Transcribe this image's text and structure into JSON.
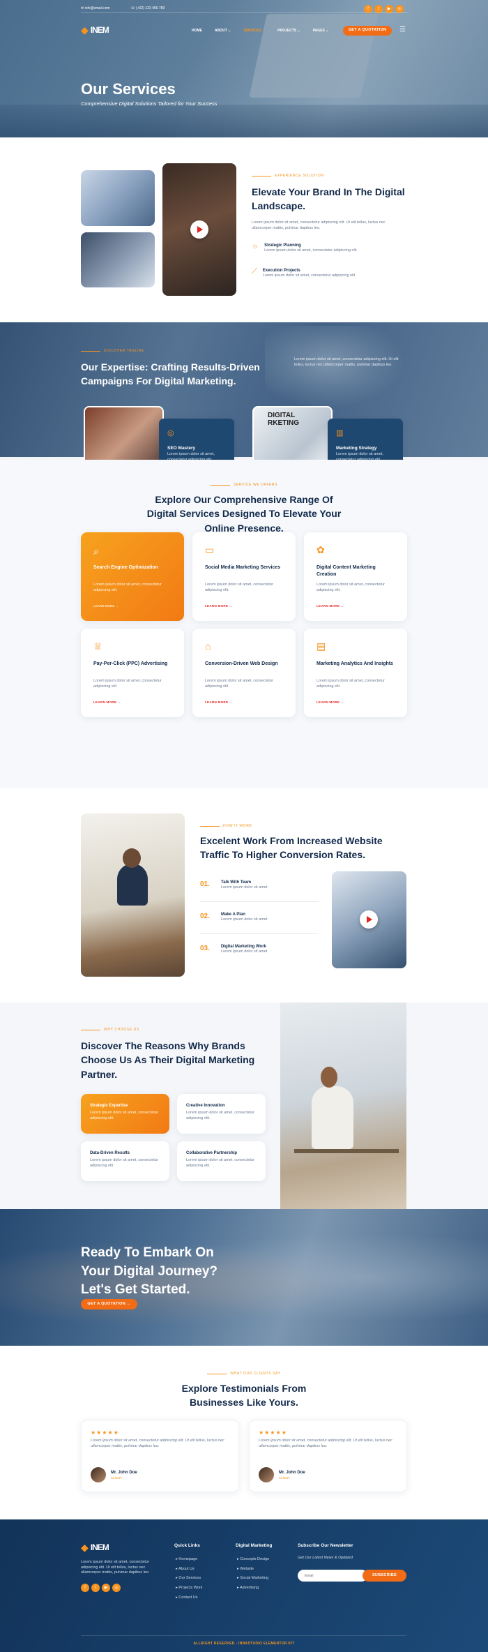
{
  "topbar": {
    "email": "info@email.com",
    "phone": "(+62) 123 456 789"
  },
  "brand": {
    "logo": "INEM"
  },
  "nav": {
    "items": [
      "HOME",
      "ABOUT",
      "SERVICES",
      "PROJECTS",
      "PAGES"
    ],
    "cta": "GET A QUOTATION"
  },
  "hero": {
    "title": "Our Services",
    "subtitle": "Comprehensive Digital Solutions Tailored for Your Success"
  },
  "elevate": {
    "kicker": "EXPERIENCE SOLUTION",
    "title": "Elevate Your Brand In The Digital Landscape.",
    "body": "Lorem ipsum dolor sit amet, consectetur adipiscing elit. Ut elit tellus, luctus nec ullamcorper mattis, pulvinar dapibus leo.",
    "items": [
      {
        "title": "Strategic Planning",
        "text": "Lorem ipsum dolor sit amet, consectetur adipiscing elit."
      },
      {
        "title": "Execution Projects",
        "text": "Lorem ipsum dolor sit amet, consectetur adipiscing elit."
      }
    ]
  },
  "expertise": {
    "kicker": "DISCOVER TAGLINE",
    "title": "Our Expertise: Crafting Results-Driven Campaigns For Digital Marketing.",
    "body": "Lorem ipsum dolor sit amet, consectetur adipiscing elit. Ut elit tellus, luctus nec ullamcorper mattis, pulvinar dapibus leo.",
    "cards": [
      {
        "title": "SEO Mastery",
        "text": "Lorem ipsum dolor sit amet, consectetur adipiscing elit."
      },
      {
        "title": "Marketing Strategy",
        "text": "Lorem ipsum dolor sit amet, consectetur adipiscing elit."
      }
    ],
    "sign": "DIGITAL\nRKETING"
  },
  "services": {
    "kicker": "SERVICE WE OFFERS",
    "title": "Explore Our Comprehensive Range Of Digital Services Designed To Elevate Your Online Presence.",
    "learn": "LEARN MORE",
    "items": [
      {
        "title": "Search Engine Optimization",
        "text": "Lorem ipsum dolor sit amet, consectetur adipiscing elit.",
        "icon": "chart-search-icon"
      },
      {
        "title": "Social Media Marketing Services",
        "text": "Lorem ipsum dolor sit amet, consectetur adipiscing elit.",
        "icon": "monitor-icon"
      },
      {
        "title": "Digital Content Marketing Creation",
        "text": "Lorem ipsum dolor sit amet, consectetur adipiscing elit.",
        "icon": "palette-icon"
      },
      {
        "title": "Pay-Per-Click (PPC) Advertising",
        "text": "Lorem ipsum dolor sit amet, consectetur adipiscing elit.",
        "icon": "trophy-icon"
      },
      {
        "title": "Conversion-Driven Web Design",
        "text": "Lorem ipsum dolor sit amet, consectetur adipiscing elit.",
        "icon": "bank-icon"
      },
      {
        "title": "Marketing Analytics And Insights",
        "text": "Lorem ipsum dolor sit amet, consectetur adipiscing elit.",
        "icon": "analytics-icon"
      }
    ]
  },
  "work": {
    "kicker": "HOW IT WORK",
    "title": "Excelent Work From Increased Website Traffic To Higher Conversion Rates.",
    "steps": [
      {
        "num": "01.",
        "title": "Talk With Team",
        "text": "Lorem ipsum dolor sit amet"
      },
      {
        "num": "02.",
        "title": "Make A Plan",
        "text": "Lorem ipsum dolor sit amet"
      },
      {
        "num": "03.",
        "title": "Digital Marketing Work",
        "text": "Lorem ipsum dolor sit amet"
      }
    ]
  },
  "why": {
    "kicker": "WHY CHOOSE US",
    "title": "Discover The Reasons Why Brands Choose Us As Their Digital Marketing Partner.",
    "items": [
      {
        "title": "Strategic Expertise",
        "text": "Lorem ipsum dolor sit amet, consectetur adipiscing elit."
      },
      {
        "title": "Creative Innovation",
        "text": "Lorem ipsum dolor sit amet, consectetur adipiscing elit."
      },
      {
        "title": "Data-Driven Results",
        "text": "Lorem ipsum dolor sit amet, consectetur adipiscing elit."
      },
      {
        "title": "Collaborative Partnership",
        "text": "Lorem ipsum dolor sit amet, consectetur adipiscing elit."
      }
    ]
  },
  "cta": {
    "title": "Ready To Embark On Your Digital Journey? Let's Get Started.",
    "button": "GET A QUOTATION"
  },
  "testimonials": {
    "kicker": "WHAT OUR CLIENTS SAY",
    "title": "Explore Testimonials From Businesses Like Yours.",
    "items": [
      {
        "stars": "★★★★★",
        "text": "Lorem ipsum dolor sit amet, consectetur adipiscing elit. Ut elit tellus, luctus nec ullamcorper mattis, pulvinar dapibus leo.",
        "name": "Mr. John Doe",
        "role": "CLIENT"
      },
      {
        "stars": "★★★★★",
        "text": "Lorem ipsum dolor sit amet, consectetur adipiscing elit. Ut elit tellus, luctus nec ullamcorper mattis, pulvinar dapibus leo.",
        "name": "Mr. John Doe",
        "role": "CLIENT"
      }
    ]
  },
  "footer": {
    "about": "Lorem ipsum dolor sit amet, consectetur adipiscing elit. Ut elit tellus, luctus nec ullamcorper mattis, pulvinar dapibus leo.",
    "quick_title": "Quick Links",
    "quick": [
      "Homepage",
      "About Us",
      "Our Services",
      "Projects Work",
      "Contact Us"
    ],
    "digital_title": "Digital Marketing",
    "digital": [
      "Concepts Design",
      "Website",
      "Social Marketing",
      "Advertising"
    ],
    "news_title": "Subscribe Our Newsletter",
    "news_text": "Get Our Latest News & Updated",
    "email_placeholder": "Email",
    "subscribe": "SUBSCRIBE",
    "copyright": "ALLRIGHT RESERVED - INNASTUDIO ELEMENTOR KIT"
  },
  "colors": {
    "accent": "#f7931e",
    "cta": "#f26c16",
    "navy": "#12294a",
    "footer": "#163a62"
  }
}
